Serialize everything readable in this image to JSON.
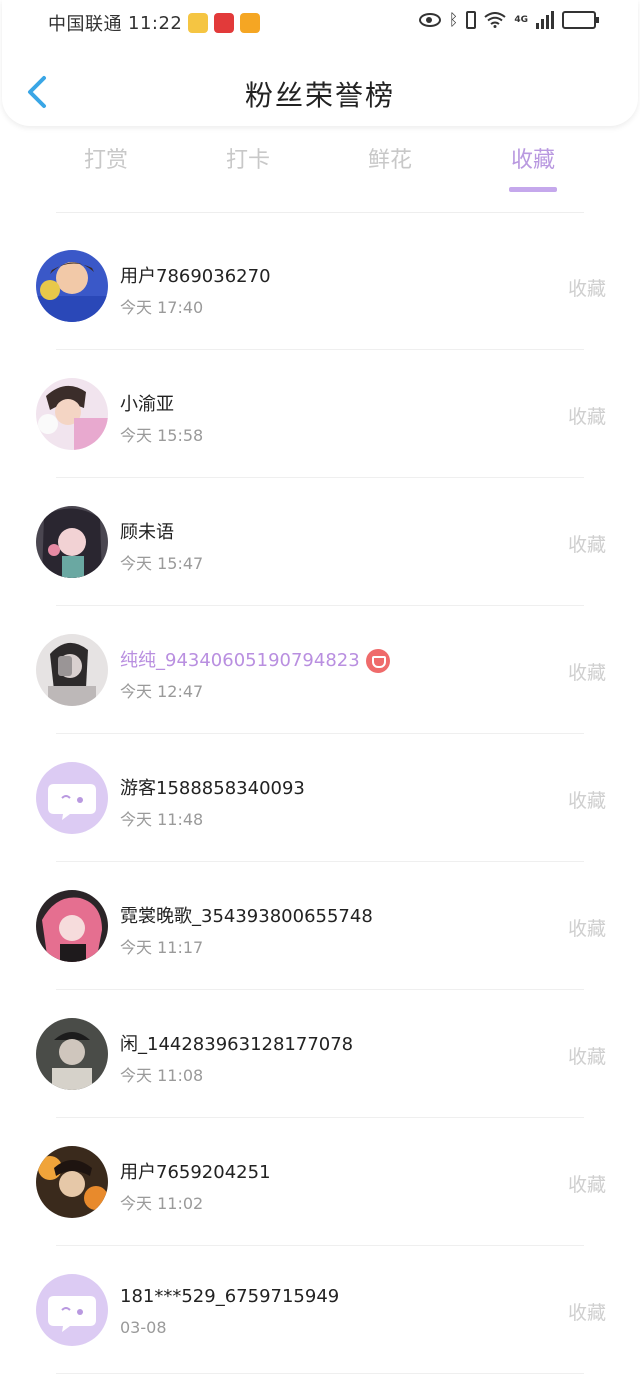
{
  "status_bar": {
    "carrier": "中国联通",
    "time": "11:22",
    "network": "4G"
  },
  "header": {
    "title": "粉丝荣誉榜",
    "back_icon": "chevron-left-icon"
  },
  "tabs": [
    {
      "label": "打赏",
      "active": false
    },
    {
      "label": "打卡",
      "active": false
    },
    {
      "label": "鲜花",
      "active": false
    },
    {
      "label": "收藏",
      "active": true
    }
  ],
  "colors": {
    "accent": "#b999e0",
    "underline": "#c5a8ec",
    "muted": "#9a9a9a",
    "action": "#cfcfcf"
  },
  "fans": [
    {
      "name": "用户7869036270",
      "time": "今天 17:40",
      "action": "收藏"
    },
    {
      "name": "小渝亚",
      "time": "今天 15:58",
      "action": "收藏"
    },
    {
      "name": "顾未语",
      "time": "今天 15:47",
      "action": "收藏"
    },
    {
      "name": "纯纯_94340605190794823",
      "time": "今天 12:47",
      "action": "收藏",
      "vip": true
    },
    {
      "name": "游客1588858340093",
      "time": "今天 11:48",
      "action": "收藏"
    },
    {
      "name": "霓裳晚歌_354393800655748",
      "time": "今天 11:17",
      "action": "收藏"
    },
    {
      "name": "闲_1442839631281770​78",
      "time": "今天 11:08",
      "action": "收藏"
    },
    {
      "name": "用户7659204251",
      "time": "今天 11:02",
      "action": "收藏"
    },
    {
      "name": "181***529_6759715949",
      "time": "03-08",
      "action": "收藏"
    }
  ]
}
